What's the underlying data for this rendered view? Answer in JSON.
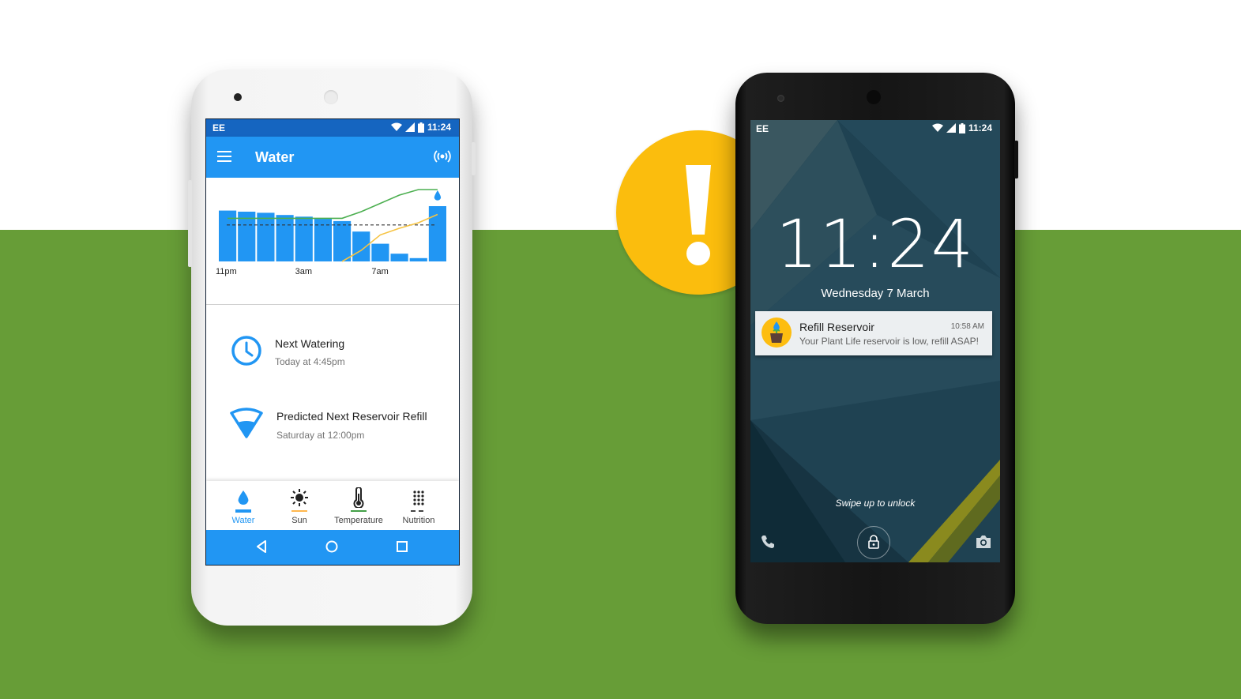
{
  "colors": {
    "background_top": "#ffffff",
    "background_bottom": "#679d37",
    "app_primary": "#2196f3",
    "status_bar": "#1565c0",
    "alert_yellow": "#fbbd0d",
    "sun_accent": "#ffb74d",
    "temperature_accent": "#43a047",
    "nutrition_accent": "#424242"
  },
  "app_phone": {
    "status_bar": {
      "carrier": "EE",
      "time": "11:24"
    },
    "app_bar": {
      "title": "Water",
      "menu_icon": "hamburger-menu-icon",
      "action_icon": "sensor-signal-icon"
    },
    "chart_data": {
      "type": "bar",
      "categories": [
        "1",
        "2",
        "3",
        "4",
        "5",
        "6",
        "7",
        "8",
        "9",
        "10",
        "11",
        "12"
      ],
      "values": [
        92,
        90,
        88,
        84,
        81,
        77,
        73,
        54,
        32,
        14,
        6,
        100
      ],
      "ylim": [
        0,
        100
      ],
      "tick_labels": [
        {
          "category": "1",
          "label": "11pm"
        },
        {
          "category": "5",
          "label": "3am"
        },
        {
          "category": "9",
          "label": "7am"
        }
      ],
      "lines": [
        {
          "color": "#4caf50",
          "values": [
            78,
            78,
            78,
            78,
            78,
            78,
            78,
            90,
            105,
            120,
            130,
            130
          ]
        },
        {
          "color": "#f6c342",
          "values": [
            null,
            null,
            null,
            null,
            null,
            null,
            0,
            20,
            48,
            60,
            70,
            85
          ]
        }
      ],
      "threshold": 66,
      "drop_icon": "water-drop-icon"
    },
    "info_rows": [
      {
        "icon": "clock-icon",
        "title": "Next Watering",
        "subtitle": "Today at 4:45pm"
      },
      {
        "icon": "reservoir-icon",
        "title": "Predicted Next Reservoir Refill",
        "subtitle": "Saturday at 12:00pm"
      }
    ],
    "bottom_nav": [
      {
        "label": "Water",
        "icon": "water-drop-icon",
        "active": true
      },
      {
        "label": "Sun",
        "icon": "sun-icon",
        "active": false
      },
      {
        "label": "Temperature",
        "icon": "thermometer-icon",
        "active": false
      },
      {
        "label": "Nutrition",
        "icon": "nutrition-dots-icon",
        "active": false
      }
    ]
  },
  "alert_badge": {
    "icon": "exclamation-icon"
  },
  "lock_phone": {
    "status_bar": {
      "carrier": "EE",
      "time": "11:24"
    },
    "clock": "11:24",
    "date": "Wednesday 7 March",
    "notification": {
      "title": "Refill Reservoir",
      "time": "10:58 AM",
      "message": "Your Plant Life reservoir is low, refill ASAP!",
      "icon": "plant-pot-icon"
    },
    "swipe_hint": "Swipe up to unlock",
    "bottom_icons": [
      "phone-icon",
      "unlock-icon",
      "camera-icon"
    ]
  }
}
